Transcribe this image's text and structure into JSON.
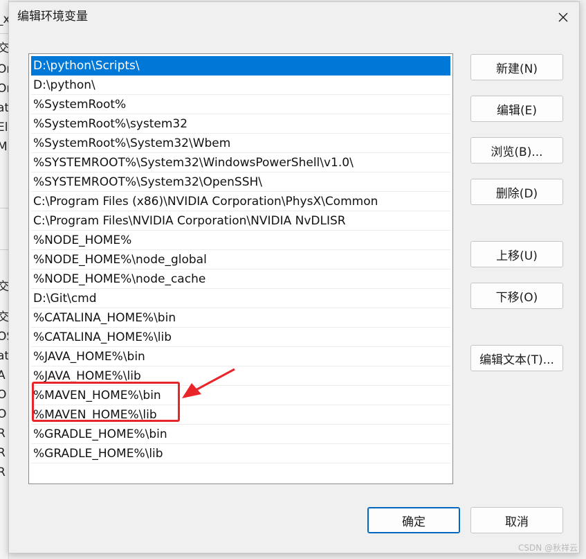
{
  "dialog": {
    "title": "编辑环境变量",
    "close_icon": "close-icon"
  },
  "path_list": [
    "D:\\python\\Scripts\\",
    "D:\\python\\",
    "%SystemRoot%",
    "%SystemRoot%\\system32",
    "%SystemRoot%\\System32\\Wbem",
    "%SYSTEMROOT%\\System32\\WindowsPowerShell\\v1.0\\",
    "%SYSTEMROOT%\\System32\\OpenSSH\\",
    "C:\\Program Files (x86)\\NVIDIA Corporation\\PhysX\\Common",
    "C:\\Program Files\\NVIDIA Corporation\\NVIDIA NvDLISR",
    "%NODE_HOME%",
    "%NODE_HOME%\\node_global",
    "%NODE_HOME%\\node_cache",
    "D:\\Git\\cmd",
    "%CATALINA_HOME%\\bin",
    "%CATALINA_HOME%\\lib",
    "%JAVA_HOME%\\bin",
    "%JAVA_HOME%\\lib",
    "%MAVEN_HOME%\\bin",
    "%MAVEN_HOME%\\lib",
    "%GRADLE_HOME%\\bin",
    "%GRADLE_HOME%\\lib"
  ],
  "buttons": {
    "new": "新建(N)",
    "edit": "编辑(E)",
    "browse": "浏览(B)...",
    "delete": "删除(D)",
    "move_up": "上移(U)",
    "move_down": "下移(O)",
    "edit_text": "编辑文本(T)...",
    "ok": "确定",
    "cancel": "取消"
  },
  "background_fragments": [
    "_x",
    "交量",
    "On",
    "On",
    "at",
    "El",
    "M",
    "交",
    "交量",
    "OS",
    "at",
    "A",
    "O",
    "O",
    "R",
    "R",
    "R"
  ],
  "watermark": "CSDN @秋祥云",
  "colors": {
    "selection": "#0078d7",
    "annotation": "#e8262a"
  }
}
